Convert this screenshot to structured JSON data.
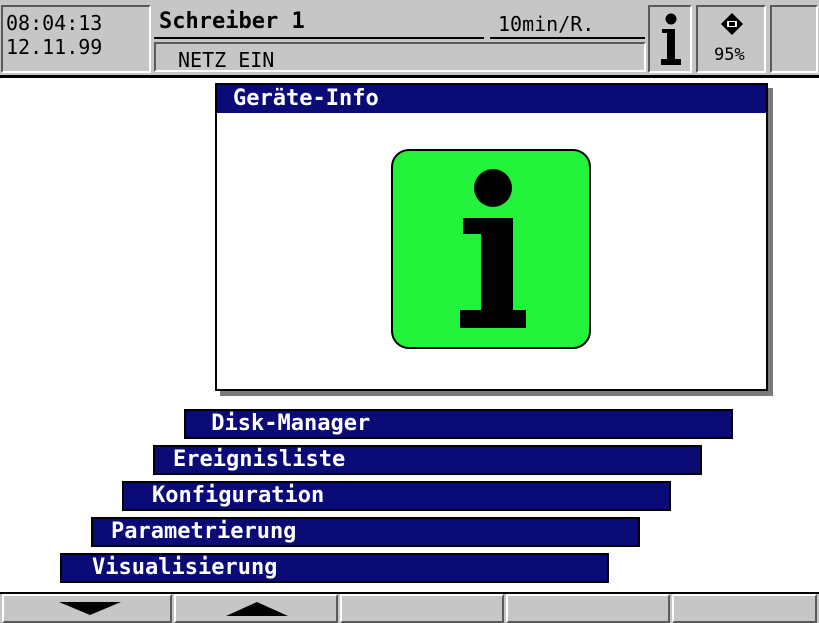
{
  "header": {
    "time": "08:04:13",
    "date": "12.11.99",
    "recorder_title": "Schreiber 1",
    "speed": "10min/R.",
    "status": "NETZ EIN",
    "info_glyph": "i",
    "card_percent": "95%",
    "card_icon": "compact-flash-card-icon"
  },
  "dialog": {
    "title": "Geräte-Info",
    "icon": "info-icon",
    "icon_color": "#22f23a"
  },
  "menu": {
    "items": [
      {
        "label": " Disk-Manager"
      },
      {
        "label": "Ereignisliste"
      },
      {
        "label": "Konfiguration"
      },
      {
        "label": "Parametrierung"
      },
      {
        "label": "Visualisierung"
      }
    ]
  },
  "softkeys": {
    "items": [
      {
        "icon": "arrow-down-icon"
      },
      {
        "icon": "arrow-up-icon"
      },
      {
        "icon": ""
      },
      {
        "icon": ""
      },
      {
        "icon": ""
      }
    ]
  },
  "colors": {
    "panel_gray": "#c6c6c6",
    "navy": "#0b0b78",
    "green": "#22f23a"
  }
}
